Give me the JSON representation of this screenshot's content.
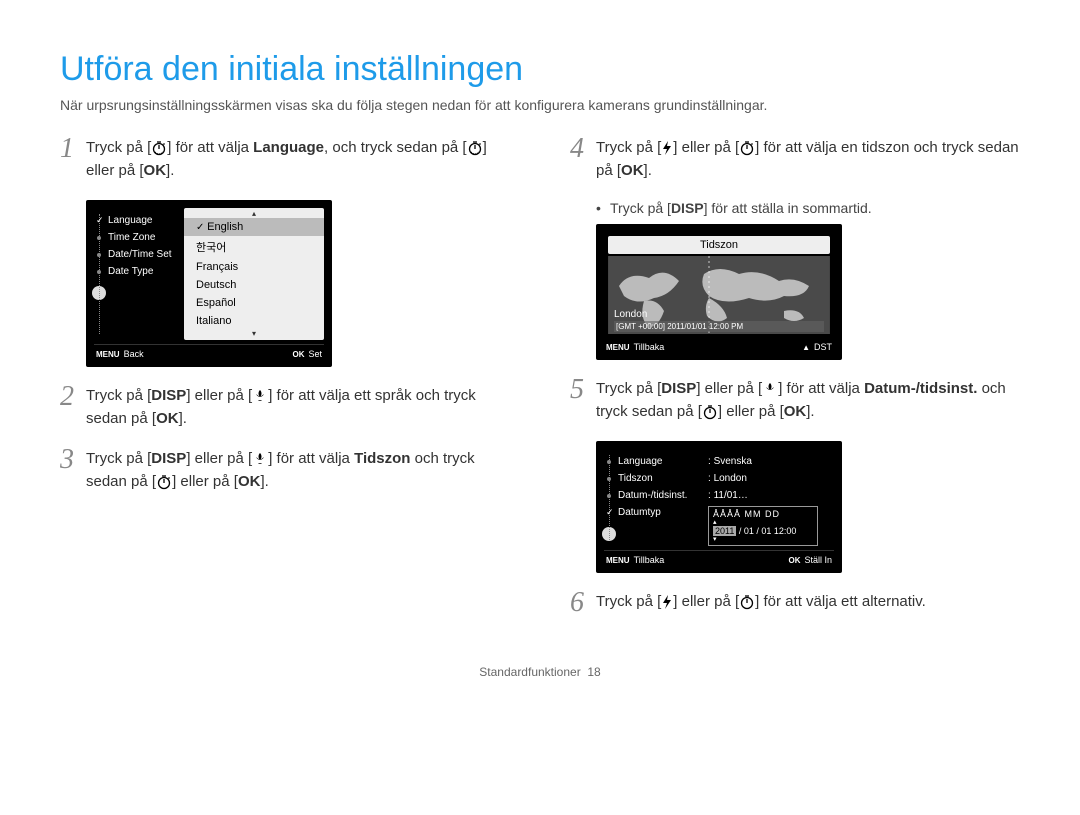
{
  "title": "Utföra den initiala inställningen",
  "intro": "När urpsrungsinställningsskärmen visas ska du följa stegen nedan för att konfigurera kamerans grundinställningar.",
  "steps": {
    "s1": {
      "p1": "Tryck på [",
      "p2": "] för att välja ",
      "bold1": "Language",
      "p3": ", och tryck sedan på [",
      "p4": "] eller på [",
      "ok": "OK",
      "p5": "]."
    },
    "s2": {
      "p1": "Tryck på [",
      "disp": "DISP",
      "p2": "] eller på [",
      "p3": "] för att välja ett språk och tryck sedan på [",
      "ok": "OK",
      "p4": "]."
    },
    "s3": {
      "p1": "Tryck på [",
      "disp": "DISP",
      "p2": "] eller på [",
      "p3": "] för att välja ",
      "bold1": "Tidszon",
      "p4": " och tryck sedan på [",
      "p5": "] eller på [",
      "ok": "OK",
      "p6": "]."
    },
    "s4": {
      "p1": "Tryck på [",
      "p2": "] eller på [",
      "p3": "] för att välja en tidszon och tryck sedan på [",
      "ok": "OK",
      "p4": "]."
    },
    "s4b": {
      "p1": "Tryck på [",
      "disp": "DISP",
      "p2": "] för att ställa in sommartid."
    },
    "s5": {
      "p1": "Tryck på [",
      "disp": "DISP",
      "p2": "] eller på [",
      "p3": "] för att välja ",
      "bold1": "Datum-/tidsinst.",
      "p4": " och tryck sedan på [",
      "p5": "] eller på [",
      "ok": "OK",
      "p6": "]."
    },
    "s6": {
      "p1": "Tryck på [",
      "p2": "] eller på [",
      "p3": "] för att välja ett alternativ."
    }
  },
  "screen1": {
    "side": [
      "Language",
      "Time Zone",
      "Date/Time Set",
      "Date Type"
    ],
    "opts": [
      "English",
      "한국어",
      "Français",
      "Deutsch",
      "Español",
      "Italiano"
    ],
    "footer_menu": "MENU",
    "footer_back": "Back",
    "footer_ok": "OK",
    "footer_set": "Set"
  },
  "screen2": {
    "title": "Tidszon",
    "location": "London",
    "gmt": "[GMT +00:00] 2011/01/01 12:00 PM",
    "footer_menu": "MENU",
    "footer_back": "Tillbaka",
    "dst": "DST"
  },
  "screen3": {
    "side": [
      "Language",
      "Tidszon",
      "Datum-/tidsinst.",
      "Datumtyp"
    ],
    "vals": [
      "Svenska",
      "London",
      "11/01…"
    ],
    "fmt_head": "ÅÅÅÅ MM DD",
    "fmt_year": "2011",
    "fmt_rest": "/ 01 / 01 12:00",
    "footer_menu": "MENU",
    "footer_back": "Tillbaka",
    "footer_ok": "OK",
    "footer_set": "Ställ In"
  },
  "page_footer_label": "Standardfunktioner",
  "page_footer_num": "18"
}
